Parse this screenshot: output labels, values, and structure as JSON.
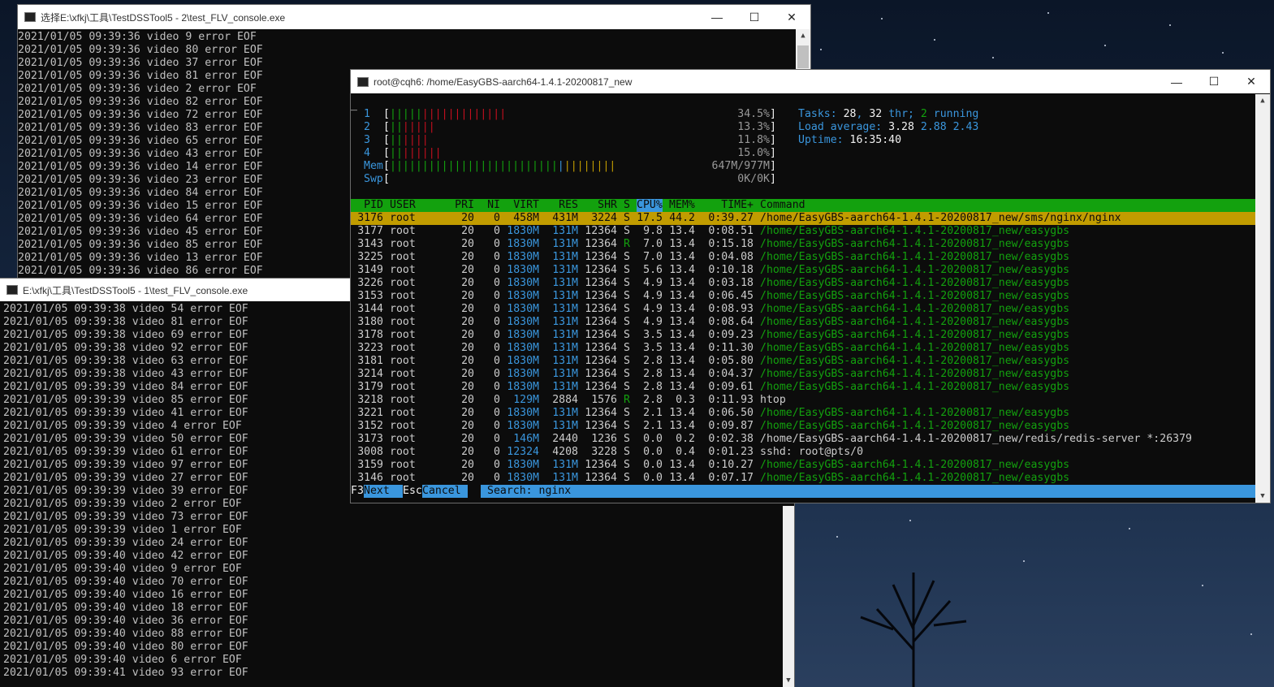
{
  "colors": {
    "accent_cyan": "#3a96dd",
    "green": "#13a10e",
    "red": "#c50f1f",
    "yellow": "#c19c00"
  },
  "win_back": {
    "title": "选择E:\\xfkj\\工具\\TestDSSTool5 - 2\\test_FLV_console.exe",
    "icon": "console-icon",
    "lines": [
      "2021/01/05 09:39:36 video 9 error EOF",
      "2021/01/05 09:39:36 video 80 error EOF",
      "2021/01/05 09:39:36 video 37 error EOF",
      "2021/01/05 09:39:36 video 81 error EOF",
      "2021/01/05 09:39:36 video 2 error EOF",
      "2021/01/05 09:39:36 video 82 error EOF",
      "2021/01/05 09:39:36 video 72 error EOF",
      "2021/01/05 09:39:36 video 83 error EOF",
      "2021/01/05 09:39:36 video 65 error EOF",
      "2021/01/05 09:39:36 video 43 error EOF",
      "2021/01/05 09:39:36 video 14 error EOF",
      "2021/01/05 09:39:36 video 23 error EOF",
      "2021/01/05 09:39:36 video 84 error EOF",
      "2021/01/05 09:39:36 video 15 error EOF",
      "2021/01/05 09:39:36 video 64 error EOF",
      "2021/01/05 09:39:36 video 45 error EOF",
      "2021/01/05 09:39:36 video 85 error EOF",
      "2021/01/05 09:39:36 video 13 error EOF",
      "2021/01/05 09:39:36 video 86 error EOF"
    ]
  },
  "win_mid": {
    "title": "E:\\xfkj\\工具\\TestDSSTool5 - 1\\test_FLV_console.exe",
    "icon": "console-icon",
    "lines": [
      "2021/01/05 09:39:38 video 54 error EOF",
      "2021/01/05 09:39:38 video 81 error EOF",
      "2021/01/05 09:39:38 video 69 error EOF",
      "2021/01/05 09:39:38 video 92 error EOF",
      "2021/01/05 09:39:38 video 63 error EOF",
      "2021/01/05 09:39:38 video 43 error EOF",
      "2021/01/05 09:39:39 video 84 error EOF",
      "2021/01/05 09:39:39 video 85 error EOF",
      "2021/01/05 09:39:39 video 41 error EOF",
      "2021/01/05 09:39:39 video 4 error EOF",
      "2021/01/05 09:39:39 video 50 error EOF",
      "2021/01/05 09:39:39 video 61 error EOF",
      "2021/01/05 09:39:39 video 97 error EOF",
      "2021/01/05 09:39:39 video 27 error EOF",
      "2021/01/05 09:39:39 video 39 error EOF",
      "2021/01/05 09:39:39 video 2 error EOF",
      "2021/01/05 09:39:39 video 73 error EOF",
      "2021/01/05 09:39:39 video 1 error EOF",
      "2021/01/05 09:39:39 video 24 error EOF",
      "2021/01/05 09:39:40 video 42 error EOF",
      "2021/01/05 09:39:40 video 9 error EOF",
      "2021/01/05 09:39:40 video 70 error EOF",
      "2021/01/05 09:39:40 video 16 error EOF",
      "2021/01/05 09:39:40 video 18 error EOF",
      "2021/01/05 09:39:40 video 36 error EOF",
      "2021/01/05 09:39:40 video 88 error EOF",
      "2021/01/05 09:39:40 video 80 error EOF",
      "2021/01/05 09:39:40 video 6 error EOF",
      "2021/01/05 09:39:41 video 93 error EOF"
    ]
  },
  "win_htop": {
    "title": "root@cqh6: /home/EasyGBS-aarch64-1.4.1-20200817_new",
    "icon": "terminal-icon",
    "cursor": "_",
    "meters": [
      {
        "label": "1",
        "value": "34.5%",
        "fill": 0.345
      },
      {
        "label": "2",
        "value": "13.3%",
        "fill": 0.133
      },
      {
        "label": "3",
        "value": "11.8%",
        "fill": 0.118
      },
      {
        "label": "4",
        "value": "15.0%",
        "fill": 0.15
      }
    ],
    "mem": {
      "label": "Mem",
      "value": "647M/977M",
      "fill": 0.66
    },
    "swp": {
      "label": "Swp",
      "value": "0K/0K",
      "fill": 0
    },
    "tasks": {
      "label": "Tasks: ",
      "count": "28",
      "sep": ", ",
      "thr": "32",
      "thr_label": " thr; ",
      "running": "2",
      "running_label": " running"
    },
    "load": {
      "label": "Load average: ",
      "v1": "3.28",
      "v2": "2.88",
      "v3": "2.43"
    },
    "uptime": {
      "label": "Uptime: ",
      "value": "16:35:40"
    },
    "headers": {
      "pid": "PID",
      "user": "USER",
      "pri": "PRI",
      "ni": "NI",
      "virt": "VIRT",
      "res": "RES",
      "shr": "SHR",
      "s": "S",
      "cpu": "CPU%",
      "mem": "MEM%",
      "time": "TIME+",
      "cmd": "Command"
    },
    "rows": [
      {
        "pid": "3176",
        "user": "root",
        "pri": "20",
        "ni": "0",
        "virt": "458M",
        "res": "431M",
        "shr": "3224",
        "s": "S",
        "cpu": "17.5",
        "mem": "44.2",
        "time": "0:39.27",
        "cmd": "/home/EasyGBS-aarch64-1.4.1-20200817_new/sms/nginx/nginx",
        "selected": true
      },
      {
        "pid": "3177",
        "user": "root",
        "pri": "20",
        "ni": "0",
        "virt": "1830M",
        "res": "131M",
        "shr": "12364",
        "s": "S",
        "cpu": "9.8",
        "mem": "13.4",
        "time": "0:08.51",
        "cmd": "/home/EasyGBS-aarch64-1.4.1-20200817_new/easygbs"
      },
      {
        "pid": "3143",
        "user": "root",
        "pri": "20",
        "ni": "0",
        "virt": "1830M",
        "res": "131M",
        "shr": "12364",
        "s": "R",
        "cpu": "7.0",
        "mem": "13.4",
        "time": "0:15.18",
        "cmd": "/home/EasyGBS-aarch64-1.4.1-20200817_new/easygbs"
      },
      {
        "pid": "3225",
        "user": "root",
        "pri": "20",
        "ni": "0",
        "virt": "1830M",
        "res": "131M",
        "shr": "12364",
        "s": "S",
        "cpu": "7.0",
        "mem": "13.4",
        "time": "0:04.08",
        "cmd": "/home/EasyGBS-aarch64-1.4.1-20200817_new/easygbs"
      },
      {
        "pid": "3149",
        "user": "root",
        "pri": "20",
        "ni": "0",
        "virt": "1830M",
        "res": "131M",
        "shr": "12364",
        "s": "S",
        "cpu": "5.6",
        "mem": "13.4",
        "time": "0:10.18",
        "cmd": "/home/EasyGBS-aarch64-1.4.1-20200817_new/easygbs"
      },
      {
        "pid": "3226",
        "user": "root",
        "pri": "20",
        "ni": "0",
        "virt": "1830M",
        "res": "131M",
        "shr": "12364",
        "s": "S",
        "cpu": "4.9",
        "mem": "13.4",
        "time": "0:03.18",
        "cmd": "/home/EasyGBS-aarch64-1.4.1-20200817_new/easygbs"
      },
      {
        "pid": "3153",
        "user": "root",
        "pri": "20",
        "ni": "0",
        "virt": "1830M",
        "res": "131M",
        "shr": "12364",
        "s": "S",
        "cpu": "4.9",
        "mem": "13.4",
        "time": "0:06.45",
        "cmd": "/home/EasyGBS-aarch64-1.4.1-20200817_new/easygbs"
      },
      {
        "pid": "3144",
        "user": "root",
        "pri": "20",
        "ni": "0",
        "virt": "1830M",
        "res": "131M",
        "shr": "12364",
        "s": "S",
        "cpu": "4.9",
        "mem": "13.4",
        "time": "0:08.93",
        "cmd": "/home/EasyGBS-aarch64-1.4.1-20200817_new/easygbs"
      },
      {
        "pid": "3180",
        "user": "root",
        "pri": "20",
        "ni": "0",
        "virt": "1830M",
        "res": "131M",
        "shr": "12364",
        "s": "S",
        "cpu": "4.9",
        "mem": "13.4",
        "time": "0:08.64",
        "cmd": "/home/EasyGBS-aarch64-1.4.1-20200817_new/easygbs"
      },
      {
        "pid": "3178",
        "user": "root",
        "pri": "20",
        "ni": "0",
        "virt": "1830M",
        "res": "131M",
        "shr": "12364",
        "s": "S",
        "cpu": "3.5",
        "mem": "13.4",
        "time": "0:09.23",
        "cmd": "/home/EasyGBS-aarch64-1.4.1-20200817_new/easygbs"
      },
      {
        "pid": "3223",
        "user": "root",
        "pri": "20",
        "ni": "0",
        "virt": "1830M",
        "res": "131M",
        "shr": "12364",
        "s": "S",
        "cpu": "3.5",
        "mem": "13.4",
        "time": "0:11.30",
        "cmd": "/home/EasyGBS-aarch64-1.4.1-20200817_new/easygbs"
      },
      {
        "pid": "3181",
        "user": "root",
        "pri": "20",
        "ni": "0",
        "virt": "1830M",
        "res": "131M",
        "shr": "12364",
        "s": "S",
        "cpu": "2.8",
        "mem": "13.4",
        "time": "0:05.80",
        "cmd": "/home/EasyGBS-aarch64-1.4.1-20200817_new/easygbs"
      },
      {
        "pid": "3214",
        "user": "root",
        "pri": "20",
        "ni": "0",
        "virt": "1830M",
        "res": "131M",
        "shr": "12364",
        "s": "S",
        "cpu": "2.8",
        "mem": "13.4",
        "time": "0:04.37",
        "cmd": "/home/EasyGBS-aarch64-1.4.1-20200817_new/easygbs"
      },
      {
        "pid": "3179",
        "user": "root",
        "pri": "20",
        "ni": "0",
        "virt": "1830M",
        "res": "131M",
        "shr": "12364",
        "s": "S",
        "cpu": "2.8",
        "mem": "13.4",
        "time": "0:09.61",
        "cmd": "/home/EasyGBS-aarch64-1.4.1-20200817_new/easygbs"
      },
      {
        "pid": "3218",
        "user": "root",
        "pri": "20",
        "ni": "0",
        "virt": "129M",
        "res": "2884",
        "shr": "1576",
        "s": "R",
        "cpu": "2.8",
        "mem": "0.3",
        "time": "0:11.93",
        "cmd": "htop",
        "plain": true
      },
      {
        "pid": "3221",
        "user": "root",
        "pri": "20",
        "ni": "0",
        "virt": "1830M",
        "res": "131M",
        "shr": "12364",
        "s": "S",
        "cpu": "2.1",
        "mem": "13.4",
        "time": "0:06.50",
        "cmd": "/home/EasyGBS-aarch64-1.4.1-20200817_new/easygbs"
      },
      {
        "pid": "3152",
        "user": "root",
        "pri": "20",
        "ni": "0",
        "virt": "1830M",
        "res": "131M",
        "shr": "12364",
        "s": "S",
        "cpu": "2.1",
        "mem": "13.4",
        "time": "0:09.87",
        "cmd": "/home/EasyGBS-aarch64-1.4.1-20200817_new/easygbs"
      },
      {
        "pid": "3173",
        "user": "root",
        "pri": "20",
        "ni": "0",
        "virt": "146M",
        "res": "2440",
        "shr": "1236",
        "s": "S",
        "cpu": "0.0",
        "mem": "0.2",
        "time": "0:02.38",
        "cmd": "/home/EasyGBS-aarch64-1.4.1-20200817_new/redis/redis-server *:26379",
        "plain": true
      },
      {
        "pid": "3008",
        "user": "root",
        "pri": "20",
        "ni": "0",
        "virt": "12324",
        "res": "4208",
        "shr": "3228",
        "s": "S",
        "cpu": "0.0",
        "mem": "0.4",
        "time": "0:01.23",
        "cmd": "sshd: root@pts/0",
        "plain": true
      },
      {
        "pid": "3159",
        "user": "root",
        "pri": "20",
        "ni": "0",
        "virt": "1830M",
        "res": "131M",
        "shr": "12364",
        "s": "S",
        "cpu": "0.0",
        "mem": "13.4",
        "time": "0:10.27",
        "cmd": "/home/EasyGBS-aarch64-1.4.1-20200817_new/easygbs"
      },
      {
        "pid": "3146",
        "user": "root",
        "pri": "20",
        "ni": "0",
        "virt": "1830M",
        "res": "131M",
        "shr": "12364",
        "s": "S",
        "cpu": "0.0",
        "mem": "13.4",
        "time": "0:07.17",
        "cmd": "/home/EasyGBS-aarch64-1.4.1-20200817_new/easygbs"
      }
    ],
    "footer": {
      "f3_key": "F3",
      "f3_label": "Next  ",
      "esc_key": "Esc",
      "esc_label": "Cancel ",
      "search_label": "Search: ",
      "search_value": "nginx"
    }
  }
}
